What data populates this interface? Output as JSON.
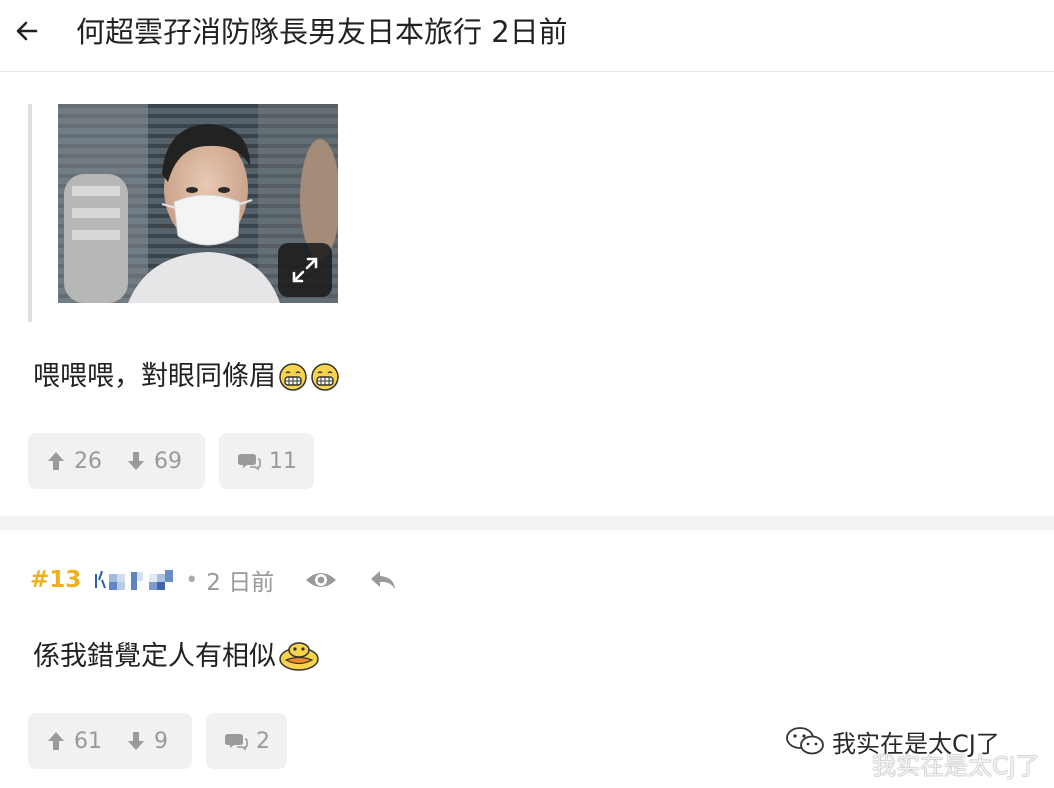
{
  "header": {
    "title": "何超雲孖消防隊長男友日本旅行 2日前"
  },
  "quoted_post": {
    "image_alt": "photo of young man wearing a white face mask"
  },
  "post_12": {
    "text": "喂喂喂，對眼同條眉",
    "emojis": [
      "grin-emoji",
      "grin-emoji"
    ],
    "upvotes": "26",
    "downvotes": "69",
    "replies": "11"
  },
  "post_13": {
    "floor": "#13",
    "time": "2 日前",
    "text": "係我錯覺定人有相似",
    "emojis": [
      "duck-emoji"
    ],
    "upvotes": "61",
    "downvotes": "9",
    "replies": "2"
  },
  "watermark": {
    "text": "我实在是太CJ了"
  },
  "colors": {
    "accent": "#f0b01c",
    "icon_gray": "#9a9a9a",
    "button_bg": "#f1f1f1"
  }
}
